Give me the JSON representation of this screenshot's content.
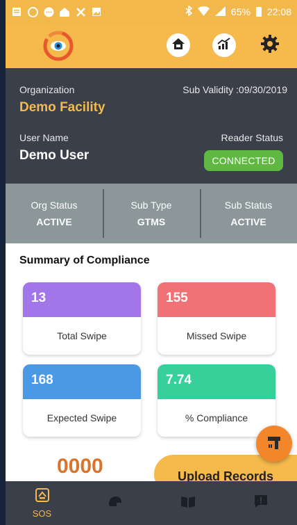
{
  "status_bar": {
    "battery": "65%",
    "time": "22:08",
    "left_icons": [
      "notes-icon",
      "whatsapp-icon",
      "chat-icon",
      "app-icon",
      "tools-icon",
      "image-icon"
    ],
    "right_icons": [
      "bluetooth-icon",
      "wifi-icon",
      "signal-icon",
      "battery-icon"
    ]
  },
  "app_bar": {
    "logo": "eye-logo",
    "actions": [
      "home-icon",
      "chart-icon",
      "settings-icon"
    ]
  },
  "organization": {
    "org_label": "Organization",
    "org_value": "Demo Facility",
    "validity_label": "Sub Validity :09/30/2019",
    "user_label": "User Name",
    "user_value": "Demo User",
    "reader_label": "Reader Status",
    "reader_value": "CONNECTED"
  },
  "status_strip": [
    {
      "label": "Org Status",
      "value": "ACTIVE"
    },
    {
      "label": "Sub Type",
      "value": "GTMS"
    },
    {
      "label": "Sub Status",
      "value": "ACTIVE"
    }
  ],
  "summary": {
    "title": "Summary of Compliance",
    "cards": [
      {
        "value": "13",
        "label": "Total Swipe",
        "color": "#a276e8"
      },
      {
        "value": "155",
        "label": "Missed Swipe",
        "color": "#f07277"
      },
      {
        "value": "168",
        "label": "Expected Swipe",
        "color": "#4b98e4"
      },
      {
        "value": "7.74",
        "label": "% Compliance",
        "color": "#37d09a"
      }
    ]
  },
  "counter": "0000",
  "upload_label": "Upload Records",
  "fab_icon": "hammer-icon",
  "bottom_nav": {
    "sos_label": "SOS",
    "items": [
      "sos-icon",
      "helmet-icon",
      "book-icon",
      "alert-icon"
    ]
  },
  "colors": {
    "accent": "#f5b94c",
    "dark": "#3a3f4a",
    "connected": "#5fb842",
    "strip": "#8b9799",
    "orange": "#d8742e"
  }
}
